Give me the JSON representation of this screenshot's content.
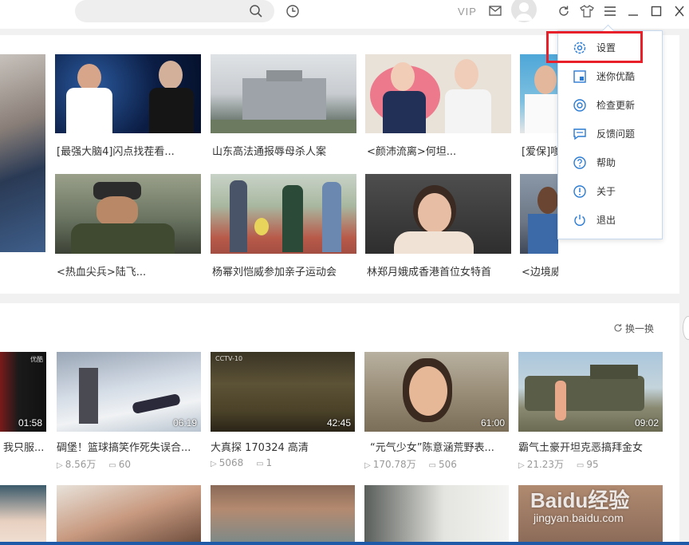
{
  "header": {
    "vip_label": "VIP",
    "search_placeholder": ""
  },
  "menu": {
    "items": [
      {
        "label": "设置",
        "icon": "gear-icon"
      },
      {
        "label": "迷你优酷",
        "icon": "mini-window-icon"
      },
      {
        "label": "检查更新",
        "icon": "update-icon"
      },
      {
        "label": "反馈问题",
        "icon": "feedback-icon"
      },
      {
        "label": "帮助",
        "icon": "help-icon"
      },
      {
        "label": "关于",
        "icon": "info-icon"
      },
      {
        "label": "退出",
        "icon": "power-icon"
      }
    ],
    "highlight_color": "#e8202a"
  },
  "featured": {
    "row1": [
      {
        "title": "[最强大脑4]闪点找茬看..."
      },
      {
        "title": "山东高法通报辱母杀人案"
      },
      {
        "title": "<颜沛流离>何坦..."
      },
      {
        "title": "[爱保]嗲..."
      }
    ],
    "row2": [
      {
        "title": "<热血尖兵>陆飞..."
      },
      {
        "title": "杨幂刘恺威参加亲子运动会"
      },
      {
        "title": "林郑月娥成香港首位女特首"
      },
      {
        "title": "<边境威龙>免费首播"
      }
    ]
  },
  "recommend": {
    "refresh_label": "换一换",
    "videos": [
      {
        "title": "我只服...",
        "duration": "01:58",
        "watermark": "优酷"
      },
      {
        "title": "碉堡！篮球搞笑作死失误合...",
        "duration": "06:19",
        "plays": "8.56万",
        "comments": "60"
      },
      {
        "title": "大真探 170324 高清",
        "duration": "42:45",
        "plays": "5068",
        "comments": "1",
        "watermark": "CCTV-10"
      },
      {
        "title": "“元气少女”陈意涵荒野表...",
        "duration": "61:00",
        "plays": "170.78万",
        "comments": "506"
      },
      {
        "title": "霸气土豪开坦克恶搞拜金女",
        "duration": "09:02",
        "plays": "21.23万",
        "comments": "95"
      }
    ]
  },
  "watermark": {
    "brand": "Baidu经验",
    "url": "jingyan.baidu.com"
  }
}
